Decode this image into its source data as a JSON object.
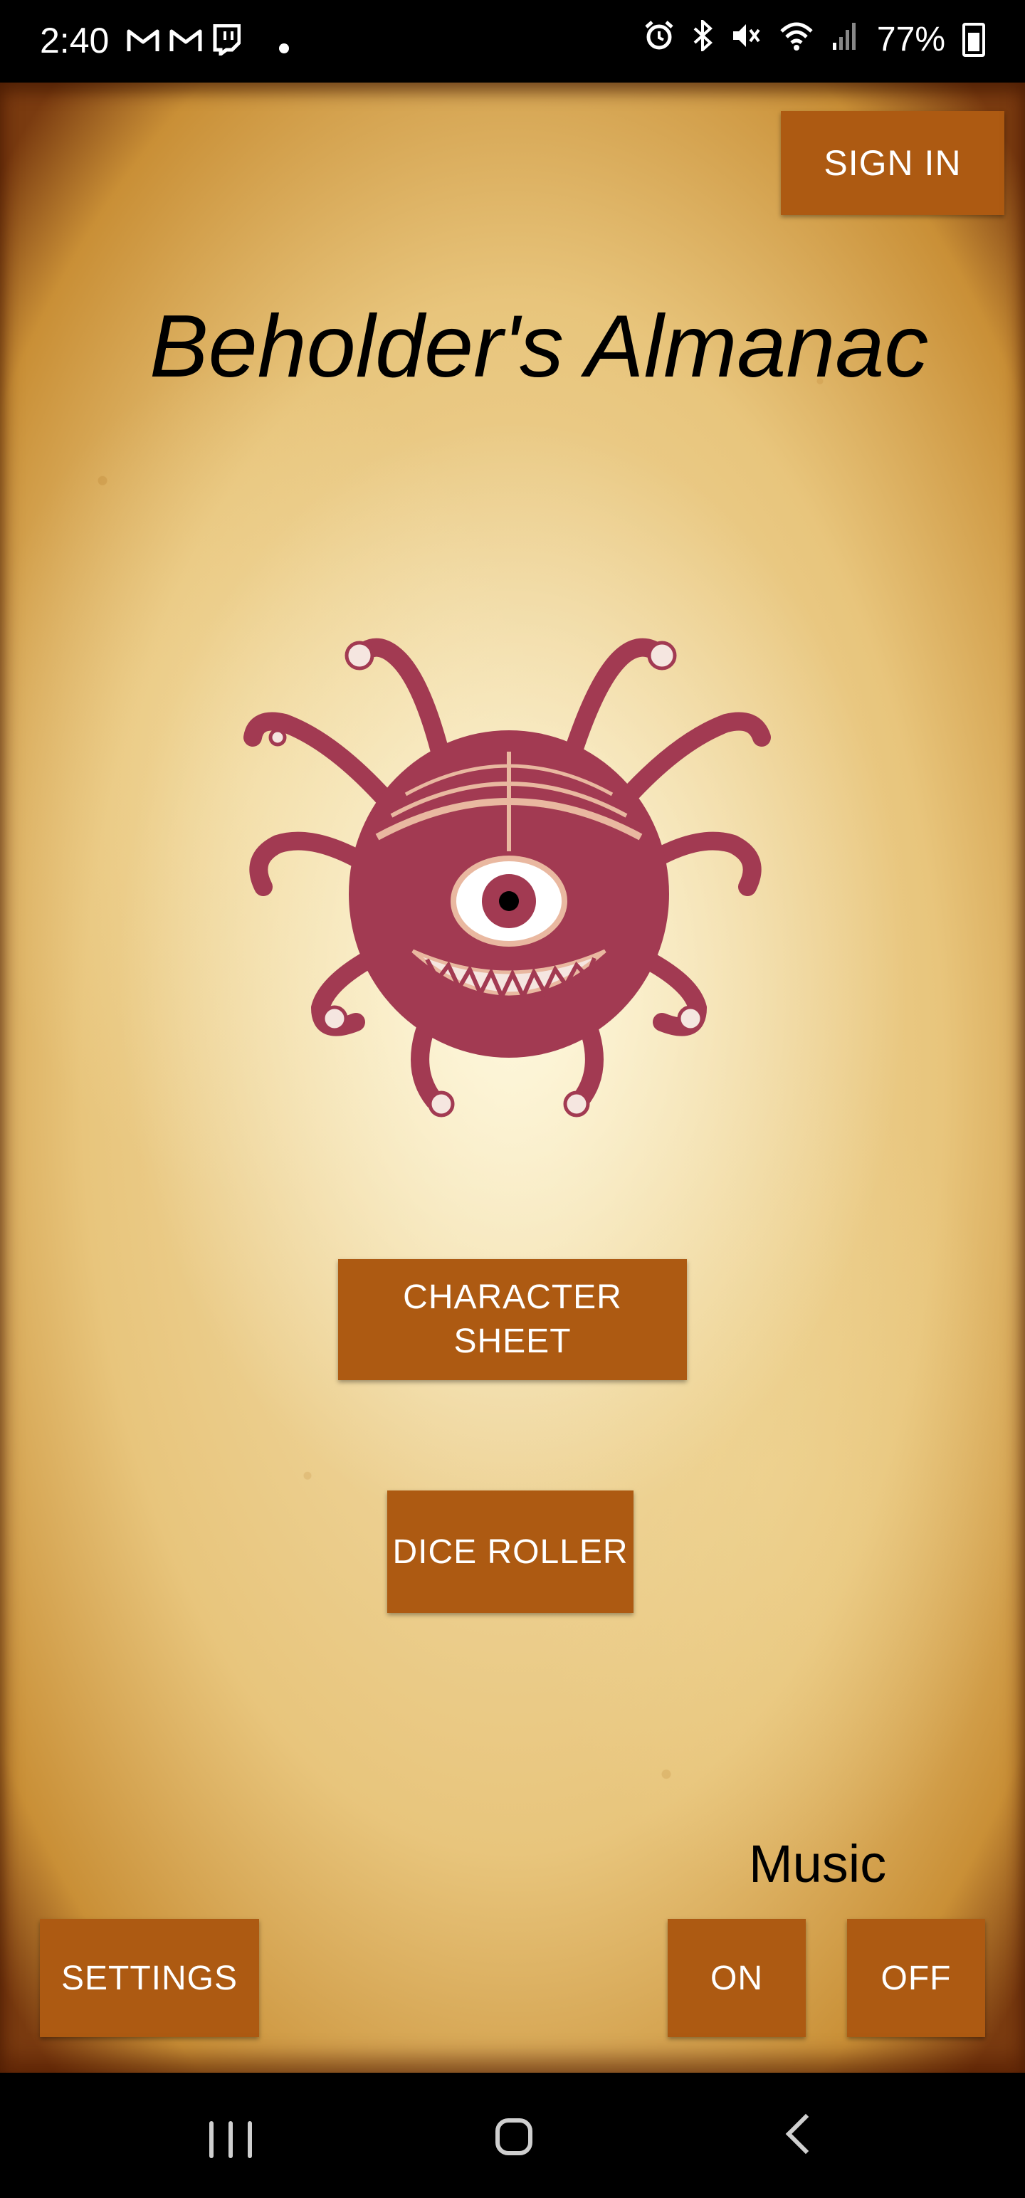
{
  "status_bar": {
    "time": "2:40",
    "battery": "77%",
    "left_icons": [
      "gmail-icon",
      "gmail-icon",
      "twitch-icon",
      "dot-icon"
    ],
    "right_icons": [
      "alarm-icon",
      "bluetooth-icon",
      "mute-icon",
      "wifi-icon",
      "signal-icon",
      "battery-icon"
    ]
  },
  "header": {
    "sign_in_label": "SIGN IN",
    "title": "Beholder's Almanac"
  },
  "main": {
    "character_sheet_line1": "CHARACTER",
    "character_sheet_line2": "SHEET",
    "dice_roller_label": "DICE ROLLER"
  },
  "footer": {
    "settings_label": "SETTINGS",
    "music_label": "Music",
    "music_on_label": "ON",
    "music_off_label": "OFF"
  },
  "colors": {
    "button": "#ad5a12",
    "parchment": "#f3e0b0",
    "beholder": "#a23a52"
  },
  "nav_bar": {
    "icons": [
      "recents-icon",
      "home-icon",
      "back-icon"
    ]
  }
}
